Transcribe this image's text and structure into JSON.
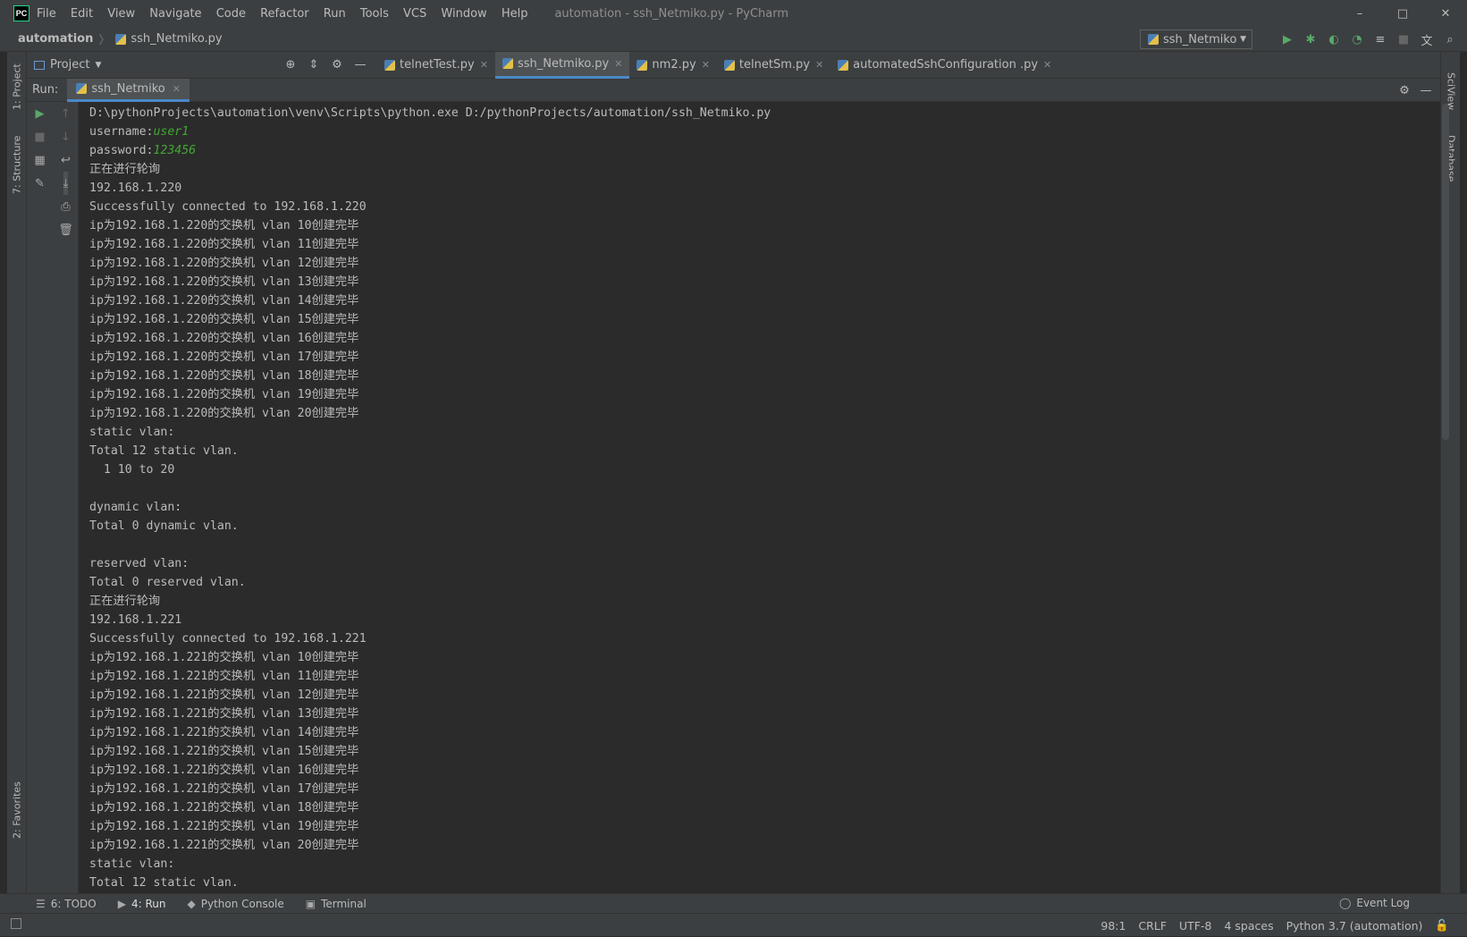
{
  "window": {
    "logo": "PC",
    "title": "automation - ssh_Netmiko.py - PyCharm",
    "menu": [
      "File",
      "Edit",
      "View",
      "Navigate",
      "Code",
      "Refactor",
      "Run",
      "Tools",
      "VCS",
      "Window",
      "Help"
    ],
    "controls": {
      "minimize": "–",
      "maximize": "□",
      "close": "✕"
    }
  },
  "navbar": {
    "project": "automation",
    "file": "ssh_Netmiko.py",
    "run_config": "ssh_Netmiko"
  },
  "left_tabs": {
    "project": "1: Project",
    "structure": "7: Structure",
    "favorites": "2: Favorites"
  },
  "right_tabs": {
    "sciview": "SciView",
    "database": "Database"
  },
  "project_selector": "Project",
  "editor_tabs": [
    {
      "label": "telnetTest.py",
      "active": false
    },
    {
      "label": "ssh_Netmiko.py",
      "active": true
    },
    {
      "label": "nm2.py",
      "active": false
    },
    {
      "label": "telnetSm.py",
      "active": false
    },
    {
      "label": "automatedSshConfiguration .py",
      "active": false
    }
  ],
  "run_panel": {
    "label": "Run:",
    "tab": "ssh_Netmiko"
  },
  "console": {
    "command": "D:\\pythonProjects\\automation\\venv\\Scripts\\python.exe D:/pythonProjects/automation/ssh_Netmiko.py",
    "username_label": "username:",
    "username_value": "user1",
    "password_label": "password:",
    "password_value": "123456",
    "lines": [
      "正在进行轮询",
      "192.168.1.220",
      "Successfully connected to 192.168.1.220",
      "ip为192.168.1.220的交换机 vlan 10创建完毕",
      "ip为192.168.1.220的交换机 vlan 11创建完毕",
      "ip为192.168.1.220的交换机 vlan 12创建完毕",
      "ip为192.168.1.220的交换机 vlan 13创建完毕",
      "ip为192.168.1.220的交换机 vlan 14创建完毕",
      "ip为192.168.1.220的交换机 vlan 15创建完毕",
      "ip为192.168.1.220的交换机 vlan 16创建完毕",
      "ip为192.168.1.220的交换机 vlan 17创建完毕",
      "ip为192.168.1.220的交换机 vlan 18创建完毕",
      "ip为192.168.1.220的交换机 vlan 19创建完毕",
      "ip为192.168.1.220的交换机 vlan 20创建完毕",
      "static vlan:",
      "Total 12 static vlan.",
      "  1 10 to 20",
      "",
      "dynamic vlan:",
      "Total 0 dynamic vlan.",
      "",
      "reserved vlan:",
      "Total 0 reserved vlan.",
      "正在进行轮询",
      "192.168.1.221",
      "Successfully connected to 192.168.1.221",
      "ip为192.168.1.221的交换机 vlan 10创建完毕",
      "ip为192.168.1.221的交换机 vlan 11创建完毕",
      "ip为192.168.1.221的交换机 vlan 12创建完毕",
      "ip为192.168.1.221的交换机 vlan 13创建完毕",
      "ip为192.168.1.221的交换机 vlan 14创建完毕",
      "ip为192.168.1.221的交换机 vlan 15创建完毕",
      "ip为192.168.1.221的交换机 vlan 16创建完毕",
      "ip为192.168.1.221的交换机 vlan 17创建完毕",
      "ip为192.168.1.221的交换机 vlan 18创建完毕",
      "ip为192.168.1.221的交换机 vlan 19创建完毕",
      "ip为192.168.1.221的交换机 vlan 20创建完毕",
      "static vlan:",
      "Total 12 static vlan."
    ]
  },
  "bottom_tabs": [
    {
      "label": "6: TODO",
      "glyph": "☰",
      "active": false
    },
    {
      "label": "4: Run",
      "glyph": "▶",
      "active": true
    },
    {
      "label": "Python Console",
      "glyph": "◆",
      "active": false
    },
    {
      "label": "Terminal",
      "glyph": "▣",
      "active": false
    }
  ],
  "event_log": "Event Log",
  "status": {
    "position": "98:1",
    "line_sep": "CRLF",
    "encoding": "UTF-8",
    "indent": "4 spaces",
    "interpreter": "Python 3.7 (automation)"
  },
  "colors": {
    "accent": "#4a88c7",
    "input_text": "#41a833",
    "run_green": "#59a869"
  }
}
